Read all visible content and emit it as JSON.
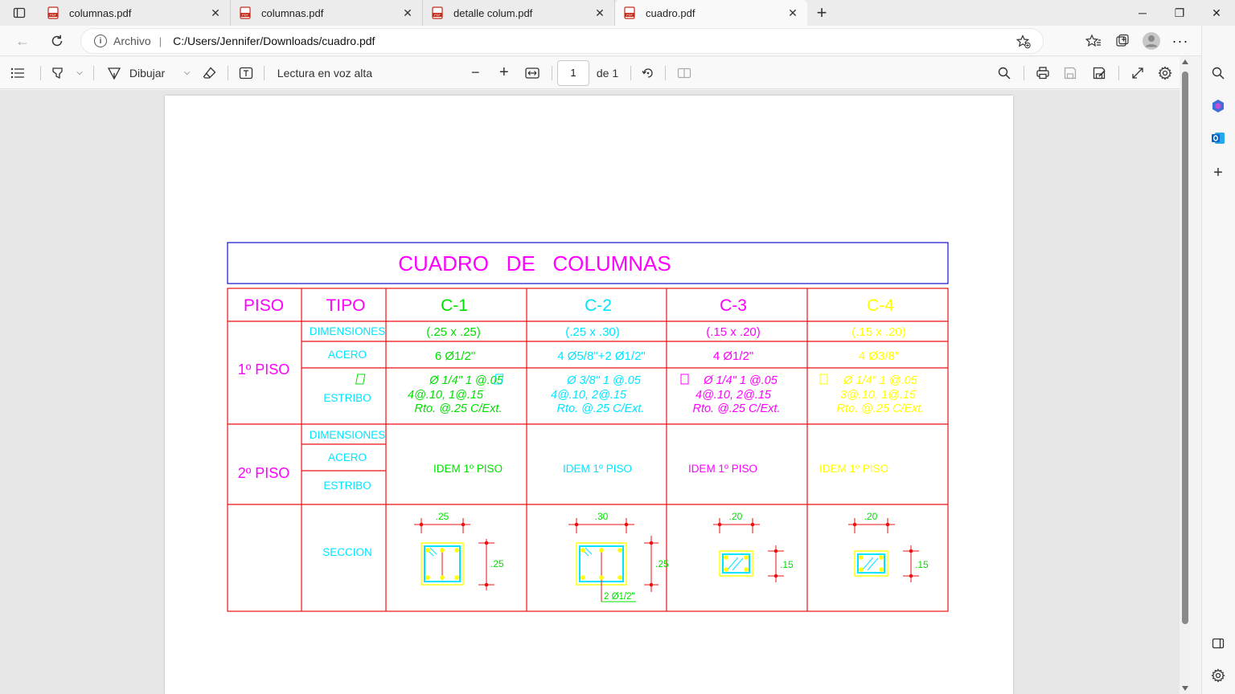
{
  "tabs": [
    {
      "title": "columnas.pdf",
      "active": false
    },
    {
      "title": "columnas.pdf",
      "active": false
    },
    {
      "title": "detalle colum.pdf",
      "active": false
    },
    {
      "title": "cuadro.pdf",
      "active": true
    }
  ],
  "address": {
    "label": "Archivo",
    "separator": "|",
    "url": "C:/Users/Jennifer/Downloads/cuadro.pdf"
  },
  "pdf_toolbar": {
    "draw_label": "Dibujar",
    "read_aloud_label": "Lectura en voz alta",
    "page_current": "1",
    "page_total": "de 1"
  },
  "document": {
    "title": "CUADRO   DE   COLUMNAS",
    "headers": {
      "piso": "PISO",
      "tipo": "TIPO"
    },
    "columns": [
      {
        "name": "C-1",
        "color": "#00e000",
        "dimensiones": "(.25 x .25)",
        "acero": "6 Ø1/2\"",
        "estribo": [
          "Ø 1/4\" 1 @.05",
          "4@.10, 1@.15",
          "Rto. @.25 C/Ext."
        ],
        "idem": "IDEM 1º PISO",
        "sec_w": ".25",
        "sec_h": ".25"
      },
      {
        "name": "C-2",
        "color": "#00e5ff",
        "dimensiones": "(.25 x .30)",
        "acero": "4 Ø5/8\"+2 Ø1/2\"",
        "estribo": [
          "Ø 3/8\" 1 @.05",
          "4@.10, 2@.15",
          "Rto. @.25 C/Ext."
        ],
        "idem": "IDEM 1º PISO",
        "sec_w": ".30",
        "sec_h": ".25",
        "sec_note": "2 Ø1/2\""
      },
      {
        "name": "C-3",
        "color": "#ff00ff",
        "dimensiones": "(.15 x .20)",
        "acero": "4 Ø1/2\"",
        "estribo": [
          "Ø  1/4\" 1 @.05",
          "4@.10, 2@.15",
          "Rto. @.25 C/Ext."
        ],
        "idem": "IDEM 1º PISO",
        "sec_w": ".20",
        "sec_h": ".15"
      },
      {
        "name": "C-4",
        "color": "#ffff00",
        "dimensiones": "(.15 x .20)",
        "acero": "4 Ø3/8\"",
        "estribo": [
          "Ø  1/4\" 1 @.05",
          "3@.10, 1@.15",
          "Rto. @.25 C/Ext."
        ],
        "idem": "IDEM 1º PISO",
        "sec_w": ".20",
        "sec_h": ".15"
      }
    ],
    "floors": [
      "1º PISO",
      "2º PISO"
    ],
    "row_labels": {
      "dimensiones": "DIMENSIONES",
      "acero": "ACERO",
      "estribo": "ESTRIBO",
      "seccion": "SECCION"
    },
    "colors": {
      "grid": "#ee1111",
      "title_border": "#1111cc",
      "title": "#ff00ff",
      "labels": "#00e5ff"
    }
  }
}
